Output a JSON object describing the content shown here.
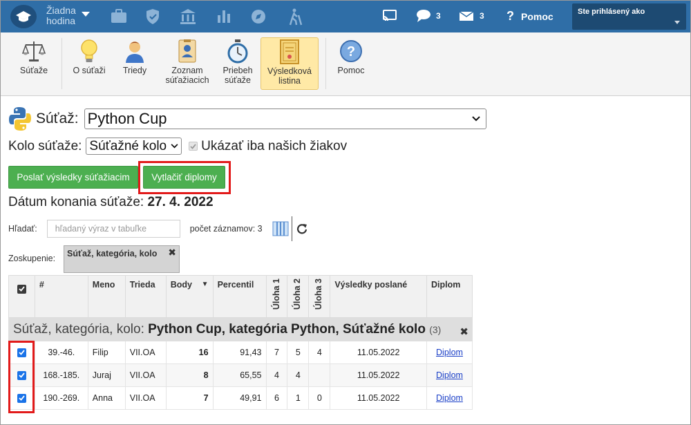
{
  "topbar": {
    "hour_line1": "Žiadna",
    "hour_line2": "hodina",
    "messages_count": "3",
    "mail_count": "3",
    "help_label": "Pomoc",
    "user_label": "Ste prihlásený ako",
    "icons": [
      "briefcase-icon",
      "shield-check-icon",
      "bank-icon",
      "bar-chart-icon",
      "compass-icon",
      "hiking-icon",
      "cast-icon",
      "chat-icon",
      "envelope-icon",
      "question-icon"
    ]
  },
  "toolbar": {
    "items": [
      {
        "label": "Súťaže"
      },
      {
        "label": "O súťaži"
      },
      {
        "label": "Triedy"
      },
      {
        "label1": "Zoznam",
        "label2": "súťažiacich"
      },
      {
        "label1": "Priebeh",
        "label2": "súťaže"
      },
      {
        "label1": "Výsledková",
        "label2": "listina"
      },
      {
        "label": "Pomoc"
      }
    ]
  },
  "competition": {
    "label": "Súťaž:",
    "value": "Python Cup",
    "round_label": "Kolo súťaže:",
    "round_value": "Súťažné kolo",
    "only_ours_label": "Ukázať iba našich žiakov",
    "btn_send": "Poslať výsledky súťažiacim",
    "btn_print": "Vytlačiť diplomy",
    "date_label": "Dátum konania súťaže:",
    "date_value": "27. 4. 2022"
  },
  "search": {
    "label": "Hľadať:",
    "placeholder": "hľadaný výraz v tabuľke",
    "count_label": "počet záznamov: 3"
  },
  "grouping": {
    "label": "Zoskupenie:",
    "chip": "Súťaž, kategória, kolo",
    "chip_close": "✖"
  },
  "table": {
    "headers": {
      "num": "#",
      "meno": "Meno",
      "trieda": "Trieda",
      "body": "Body",
      "percentil": "Percentil",
      "u1": "Úloha 1",
      "u2": "Úloha 2",
      "u3": "Úloha 3",
      "vysledky": "Výsledky poslané",
      "diplom": "Diplom"
    },
    "group_prefix": "Súťaž, kategória, kolo:",
    "group_value": "Python Cup, kategória Python, Súťažné kolo",
    "group_count": "(3)",
    "rows": [
      {
        "num": "39.-46.",
        "meno": "Filip",
        "trieda": "VII.OA",
        "body": "16",
        "percentil": "91,43",
        "u1": "7",
        "u2": "5",
        "u3": "4",
        "vysledky": "11.05.2022",
        "diplom": "Diplom"
      },
      {
        "num": "168.-185.",
        "meno": "Juraj",
        "trieda": "VII.OA",
        "body": "8",
        "percentil": "65,55",
        "u1": "4",
        "u2": "4",
        "u3": "",
        "vysledky": "11.05.2022",
        "diplom": "Diplom"
      },
      {
        "num": "190.-269.",
        "meno": "Anna",
        "trieda": "VII.OA",
        "body": "7",
        "percentil": "49,91",
        "u1": "6",
        "u2": "1",
        "u3": "0",
        "vysledky": "11.05.2022",
        "diplom": "Diplom"
      }
    ]
  },
  "colors": {
    "topbar": "#2f6ea7",
    "button_green": "#4caf50",
    "highlight_red": "#e21a1a",
    "active_tab": "#ffe9a6",
    "checkbox_blue": "#1a73e8"
  }
}
